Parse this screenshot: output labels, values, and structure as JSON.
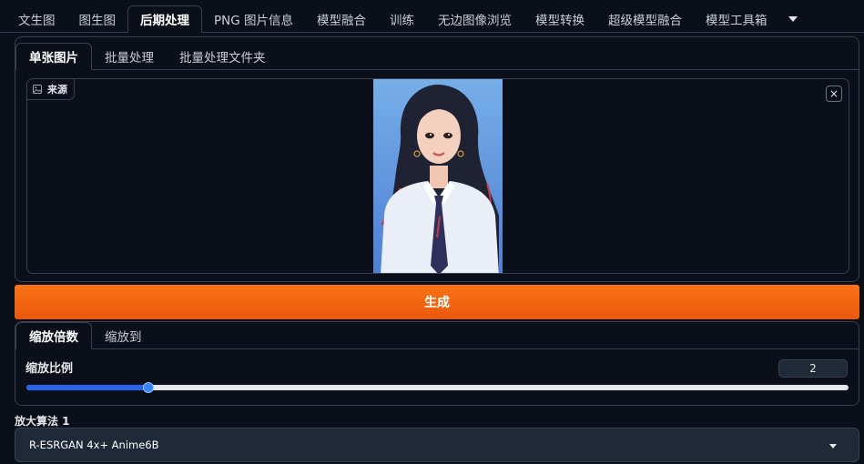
{
  "top_tabs": [
    {
      "label": "文生图",
      "active": false
    },
    {
      "label": "图生图",
      "active": false
    },
    {
      "label": "后期处理",
      "active": true
    },
    {
      "label": "PNG 图片信息",
      "active": false
    },
    {
      "label": "模型融合",
      "active": false
    },
    {
      "label": "训练",
      "active": false
    },
    {
      "label": "无边图像浏览",
      "active": false
    },
    {
      "label": "模型转换",
      "active": false
    },
    {
      "label": "超级模型融合",
      "active": false
    },
    {
      "label": "模型工具箱",
      "active": false
    }
  ],
  "sub_tabs": [
    {
      "label": "单张图片",
      "active": true
    },
    {
      "label": "批量处理",
      "active": false
    },
    {
      "label": "批量处理文件夹",
      "active": false
    }
  ],
  "image_input": {
    "label": "来源",
    "close_symbol": "×",
    "icon": "image-icon"
  },
  "generate_label": "生成",
  "resize_tabs": [
    {
      "label": "缩放倍数",
      "active": true
    },
    {
      "label": "缩放到",
      "active": false
    }
  ],
  "resize": {
    "label": "缩放比例",
    "value": "2",
    "slider_fraction": 0.148
  },
  "upscaler": {
    "label": "放大算法 1",
    "value": "R-ESRGAN 4x+ Anime6B"
  },
  "colors": {
    "accent_orange": "#f97316",
    "slider_blue": "#2563eb",
    "background": "#0b0f19"
  }
}
